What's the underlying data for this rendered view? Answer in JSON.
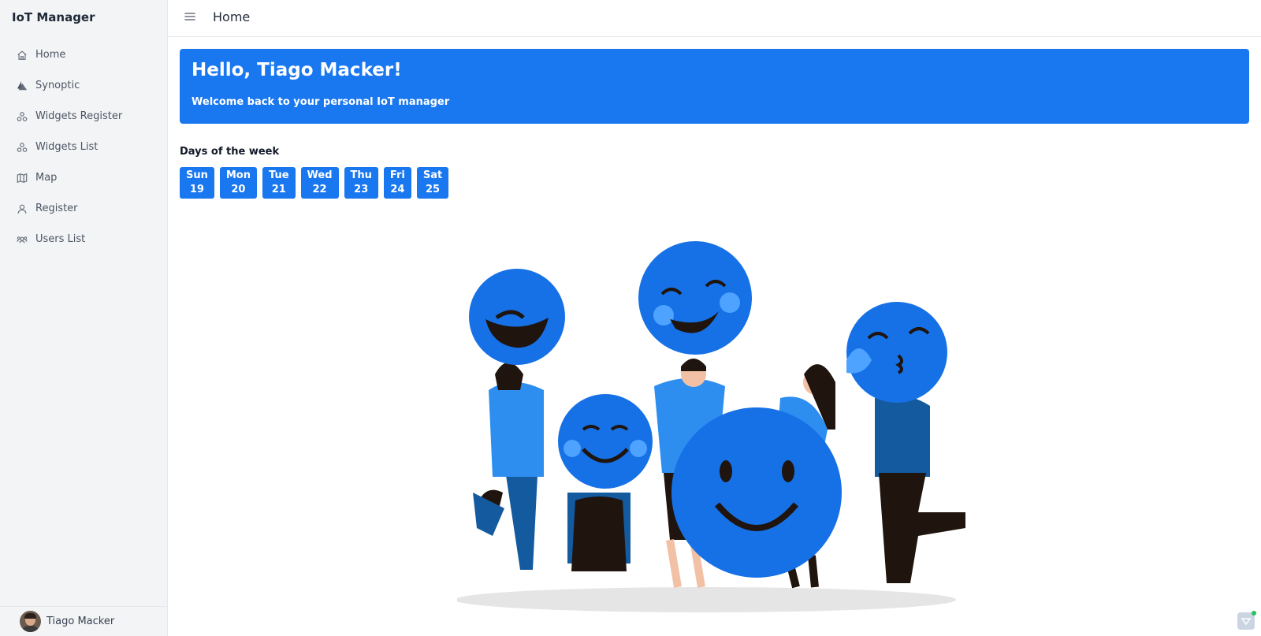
{
  "app": {
    "title": "IoT Manager"
  },
  "sidebar": {
    "items": [
      {
        "label": "Home",
        "icon": "home-icon"
      },
      {
        "label": "Synoptic",
        "icon": "synoptic-icon"
      },
      {
        "label": "Widgets Register",
        "icon": "widgets-icon"
      },
      {
        "label": "Widgets List",
        "icon": "widgets-icon"
      },
      {
        "label": "Map",
        "icon": "map-icon"
      },
      {
        "label": "Register",
        "icon": "user-icon"
      },
      {
        "label": "Users List",
        "icon": "users-icon"
      }
    ],
    "user": {
      "name": "Tiago Macker"
    }
  },
  "header": {
    "title": "Home"
  },
  "hero": {
    "title": "Hello, Tiago Macker!",
    "subtitle": "Welcome back to your personal IoT manager"
  },
  "days": {
    "heading": "Days of the week",
    "items": [
      {
        "name": "Sun",
        "date": "19"
      },
      {
        "name": "Mon",
        "date": "20"
      },
      {
        "name": "Tue",
        "date": "21"
      },
      {
        "name": "Wed",
        "date": "22"
      },
      {
        "name": "Thu",
        "date": "23"
      },
      {
        "name": "Fri",
        "date": "24"
      },
      {
        "name": "Sat",
        "date": "25"
      }
    ]
  },
  "colors": {
    "accent": "#1977f0",
    "sidebar_bg": "#f3f4f6"
  }
}
